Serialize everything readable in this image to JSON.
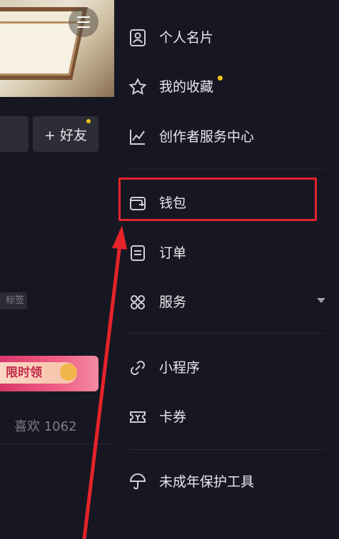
{
  "left": {
    "friend_button_label": "+ 好友",
    "tag_label": "标签",
    "promo_label": "限时领",
    "likes_label": "喜欢 1062"
  },
  "drawer": {
    "items": [
      {
        "label": "个人名片",
        "icon": "id-card-icon"
      },
      {
        "label": "我的收藏",
        "icon": "star-icon"
      },
      {
        "label": "创作者服务中心",
        "icon": "chart-icon"
      },
      {
        "label": "钱包",
        "icon": "wallet-icon"
      },
      {
        "label": "订单",
        "icon": "order-icon"
      },
      {
        "label": "服务",
        "icon": "grid-icon"
      },
      {
        "label": "小程序",
        "icon": "link-icon"
      },
      {
        "label": "卡券",
        "icon": "ticket-icon"
      },
      {
        "label": "未成年保护工具",
        "icon": "umbrella-icon"
      }
    ]
  },
  "colors": {
    "background": "#161722",
    "highlight": "#e5232a",
    "notification_dot": "#f5c518"
  }
}
